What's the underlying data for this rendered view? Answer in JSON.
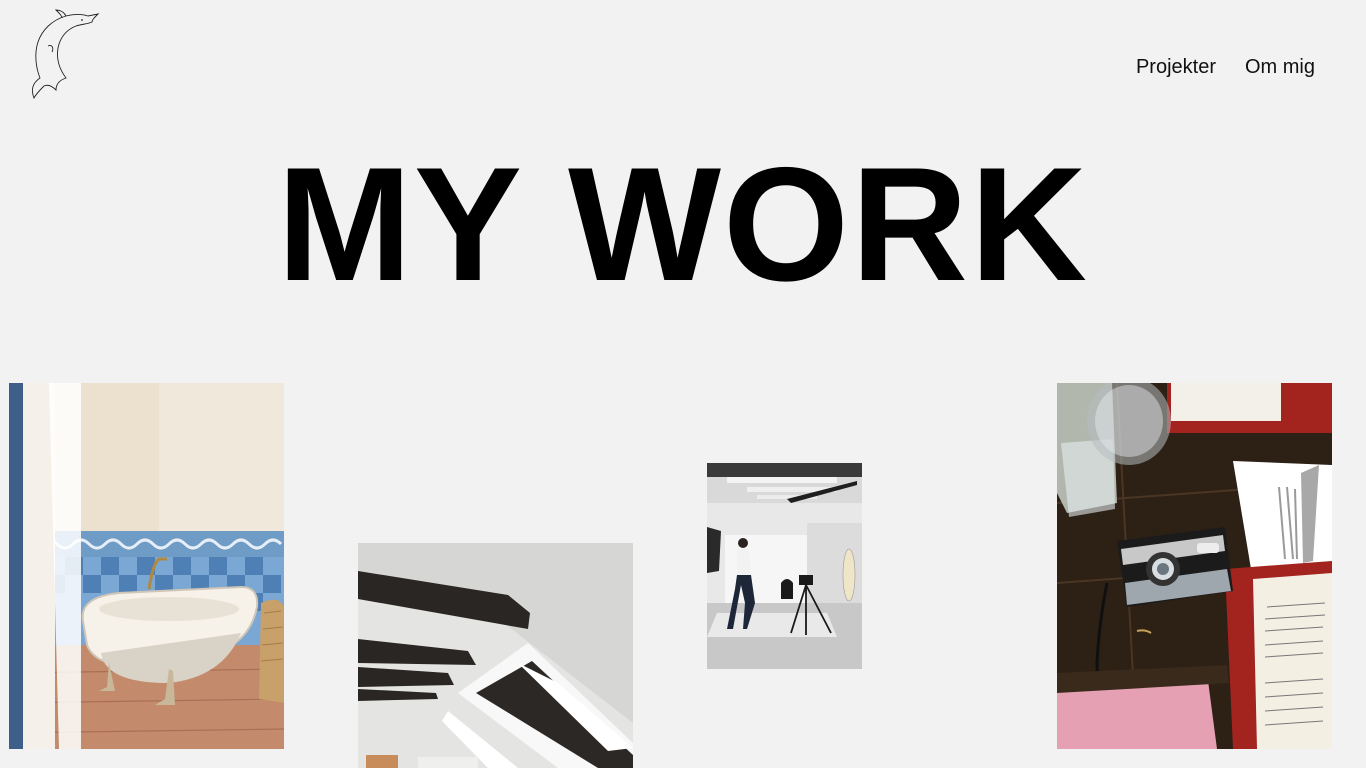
{
  "logo": {
    "icon": "dolphin-line-art-icon"
  },
  "nav": {
    "items": [
      {
        "label": "Projekter"
      },
      {
        "label": "Om mig"
      }
    ]
  },
  "hero": {
    "title": "MY WORK"
  },
  "gallery": {
    "photos": [
      {
        "subject": "bathtub-photo"
      },
      {
        "subject": "attic-beams-photo"
      },
      {
        "subject": "photo-studio-photo"
      },
      {
        "subject": "film-camera-on-table-photo"
      }
    ]
  },
  "colors": {
    "background": "#f2f2f2",
    "text": "#000000"
  }
}
